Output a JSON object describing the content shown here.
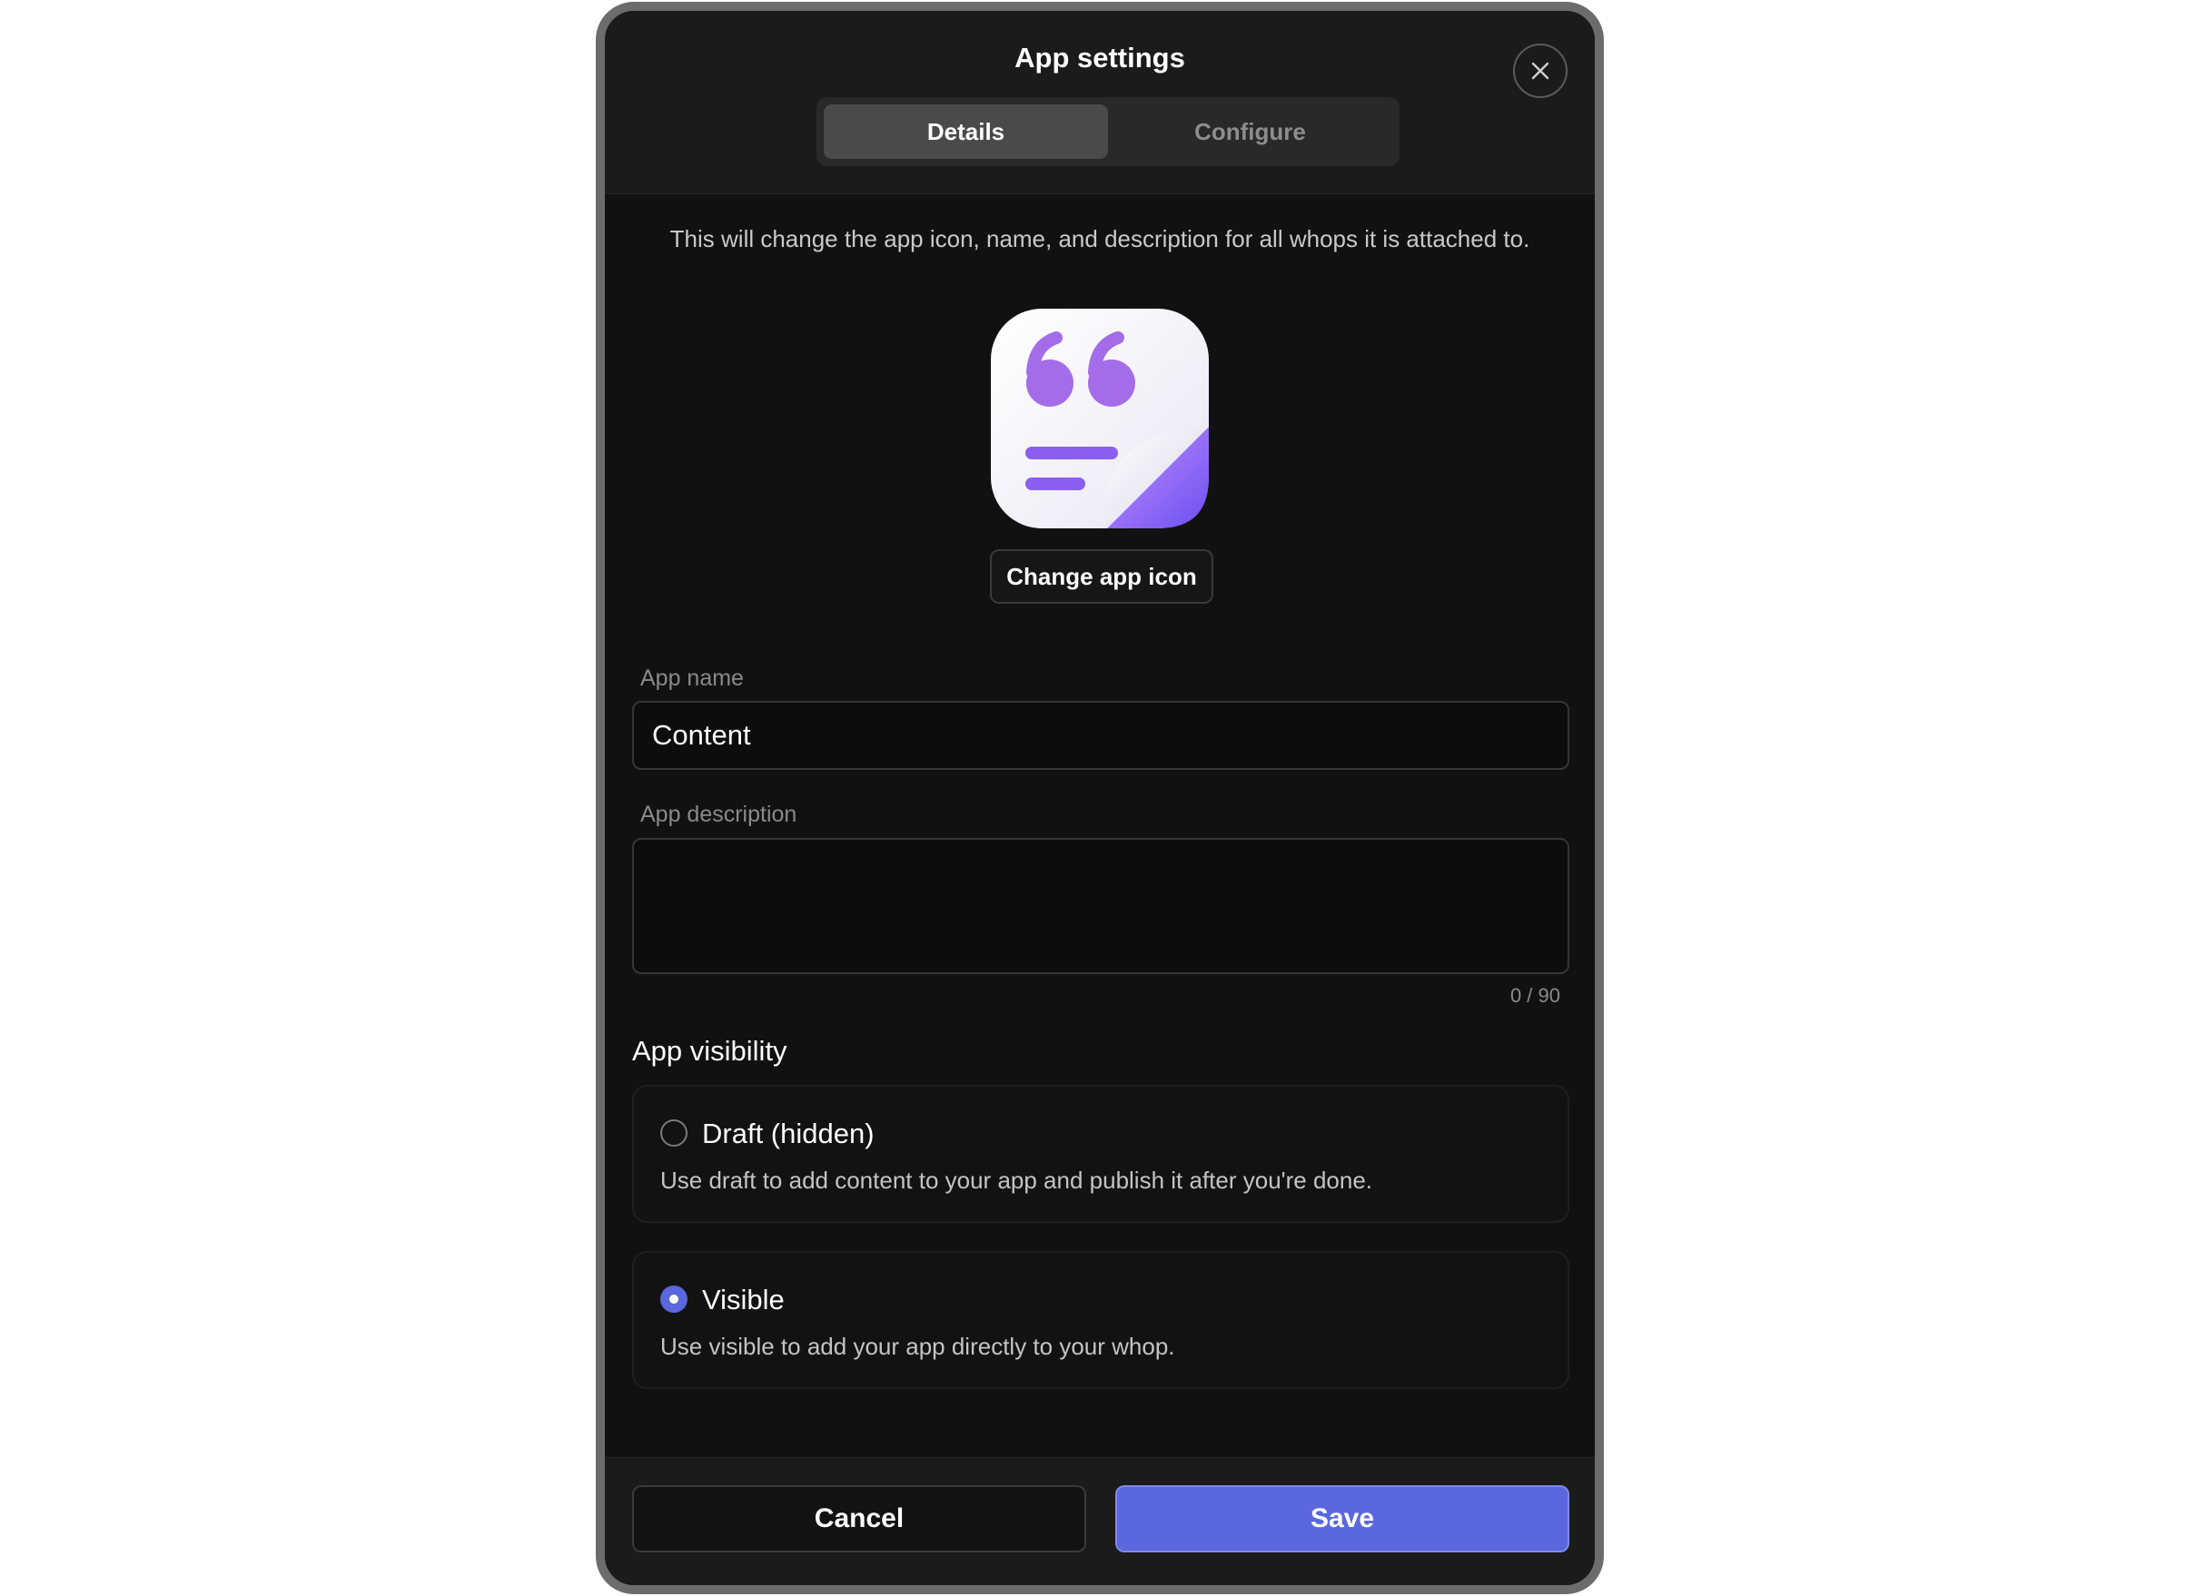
{
  "dialog": {
    "title": "App settings",
    "close_icon": "close-icon"
  },
  "tabs": [
    {
      "label": "Details",
      "active": true
    },
    {
      "label": "Configure",
      "active": false
    }
  ],
  "intro_text": "This will change the app icon, name, and description for all whops it is attached to.",
  "app_icon": {
    "icon": "quote-document-icon",
    "change_button_label": "Change app icon"
  },
  "form": {
    "name_label": "App name",
    "name_value": "Content",
    "description_label": "App description",
    "description_value": "",
    "description_counter": "0 / 90"
  },
  "visibility": {
    "title": "App visibility",
    "options": [
      {
        "label": "Draft (hidden)",
        "description": "Use draft to add content to your app and publish it after you're done.",
        "selected": false
      },
      {
        "label": "Visible",
        "description": "Use visible to add your app directly to your whop.",
        "selected": true
      }
    ]
  },
  "footer": {
    "cancel_label": "Cancel",
    "save_label": "Save"
  },
  "colors": {
    "accent": "#5b67dd",
    "icon_purple": "#a46ce8",
    "background": "#111111"
  }
}
